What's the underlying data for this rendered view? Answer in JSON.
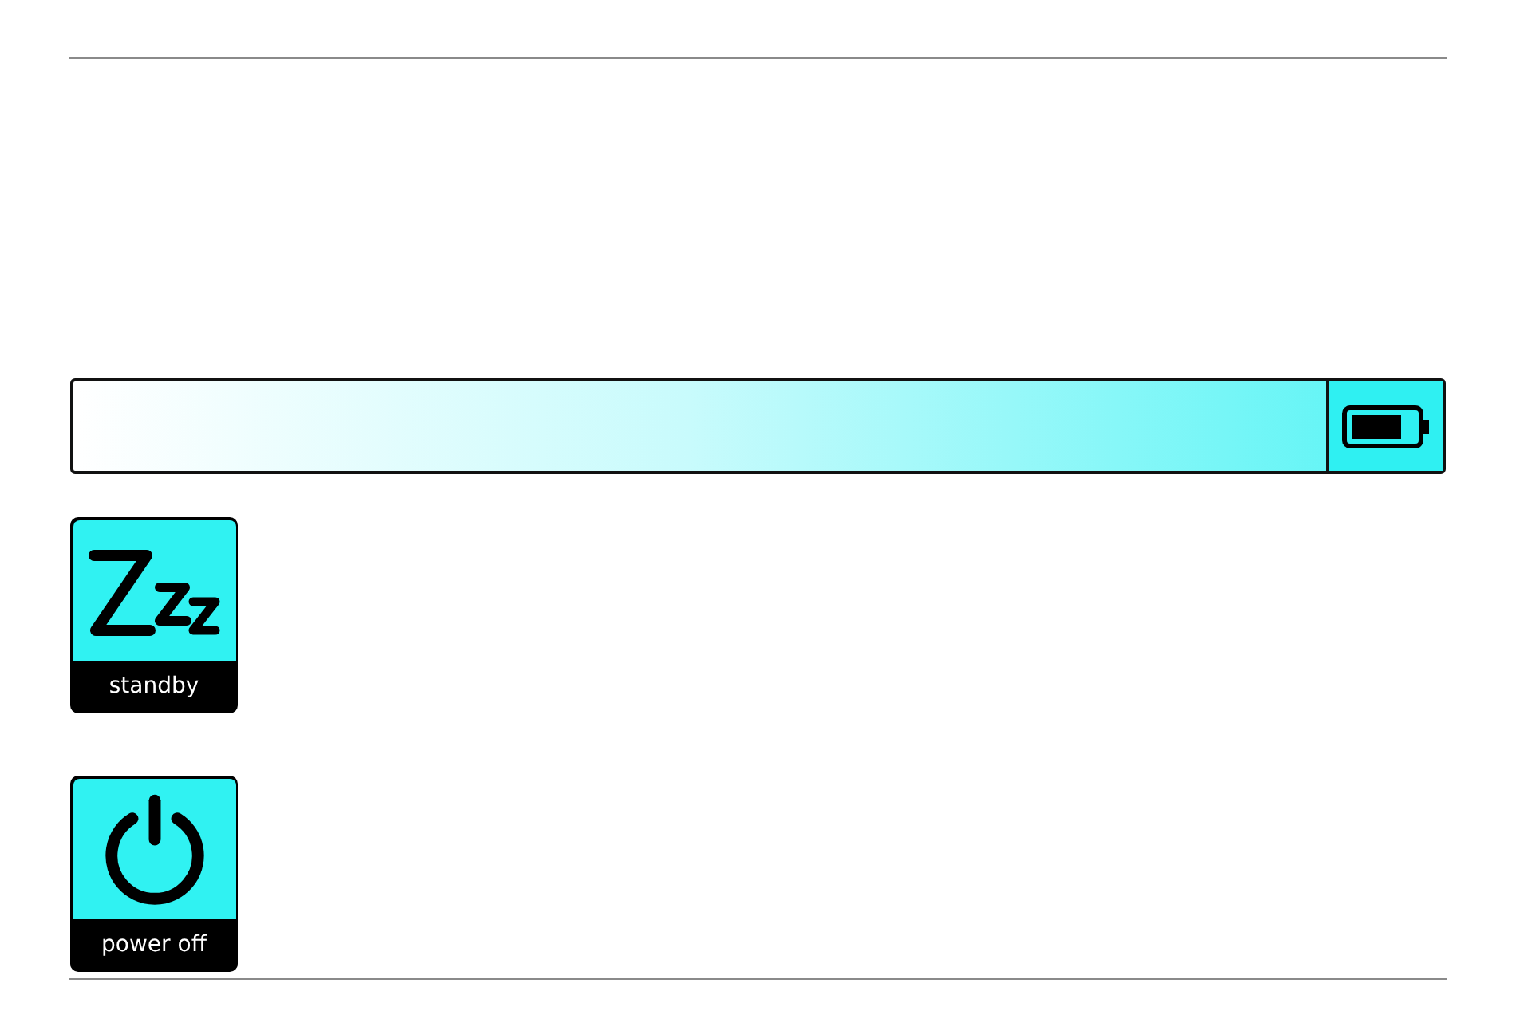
{
  "modes": [
    {
      "kind": "sleep",
      "label": "standby"
    },
    {
      "kind": "power",
      "label": "power off"
    }
  ]
}
